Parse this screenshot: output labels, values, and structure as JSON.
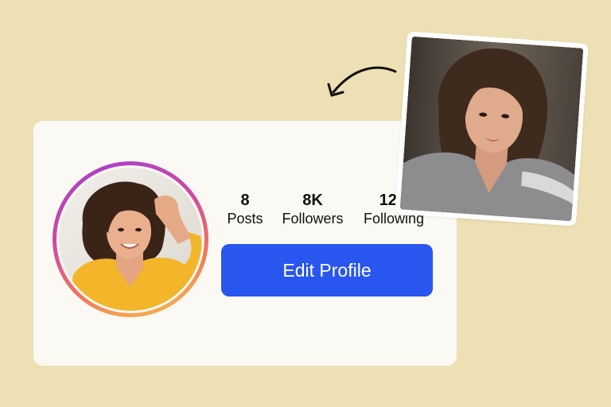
{
  "profile": {
    "stats": [
      {
        "value": "8",
        "label": "Posts"
      },
      {
        "value": "8K",
        "label": "Followers"
      },
      {
        "value": "12K",
        "label": "Following"
      }
    ],
    "edit_button_label": "Edit Profile"
  },
  "colors": {
    "background": "#ede0b4",
    "card": "#fbf9f4",
    "button": "#2a56f0",
    "ring_gradient": [
      "#a23fd0",
      "#d24aa0",
      "#f07a5a",
      "#f7c94a"
    ]
  },
  "icons": {
    "arrow": "curved-arrow-left-icon"
  }
}
